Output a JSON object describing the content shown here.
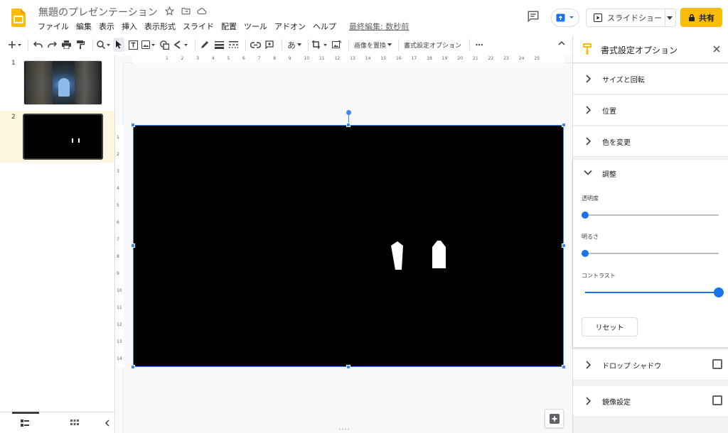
{
  "header": {
    "doc_title": "無題のプレゼンテーション",
    "menu": [
      "ファイル",
      "編集",
      "表示",
      "挿入",
      "表示形式",
      "スライド",
      "配置",
      "ツール",
      "アドオン",
      "ヘルプ"
    ],
    "last_edit": "最終編集: 数秒前",
    "slideshow_label": "スライドショー",
    "share_label": "共有",
    "icons": [
      "slides-logo-icon",
      "star-icon",
      "move-to-folder-icon",
      "cloud-status-icon",
      "comment-icon",
      "present-upload-icon",
      "play-icon",
      "lock-icon"
    ]
  },
  "toolbar": {
    "text_tool_label": "あ",
    "replace_image_label": "画像を置換",
    "format_options_label": "書式設定オプション",
    "more_label": "⋯"
  },
  "filmstrip": {
    "slides": [
      {
        "number": "1"
      },
      {
        "number": "2",
        "selected": true
      }
    ]
  },
  "ruler": {
    "h_ticks": [
      "1",
      "2",
      "3",
      "4",
      "5",
      "6",
      "7",
      "8",
      "9",
      "10",
      "11",
      "12",
      "13",
      "14",
      "15",
      "16",
      "17",
      "18",
      "19",
      "20",
      "21",
      "22",
      "23",
      "24",
      "25"
    ],
    "v_ticks": [
      "1",
      "2",
      "3",
      "4",
      "5",
      "6",
      "7",
      "8",
      "9",
      "10",
      "11",
      "12",
      "13",
      "14"
    ]
  },
  "panel": {
    "title": "書式設定オプション",
    "sections": {
      "size_rotation": "サイズと回転",
      "position": "位置",
      "recolor": "色を変更",
      "adjust": "調整",
      "drop_shadow": "ドロップ シャドウ",
      "reflection": "鏡像設定"
    },
    "adjust": {
      "transparency_label": "透明度",
      "transparency_value": 0,
      "brightness_label": "明るさ",
      "brightness_value": 0,
      "contrast_label": "コントラスト",
      "contrast_value": 100,
      "reset_label": "リセット"
    },
    "drop_shadow_checked": false,
    "reflection_checked": false
  },
  "colors": {
    "accent": "#1a73e8",
    "selection": "#4285f4",
    "share_button": "#fbbc04",
    "slide_background": "#000000"
  }
}
